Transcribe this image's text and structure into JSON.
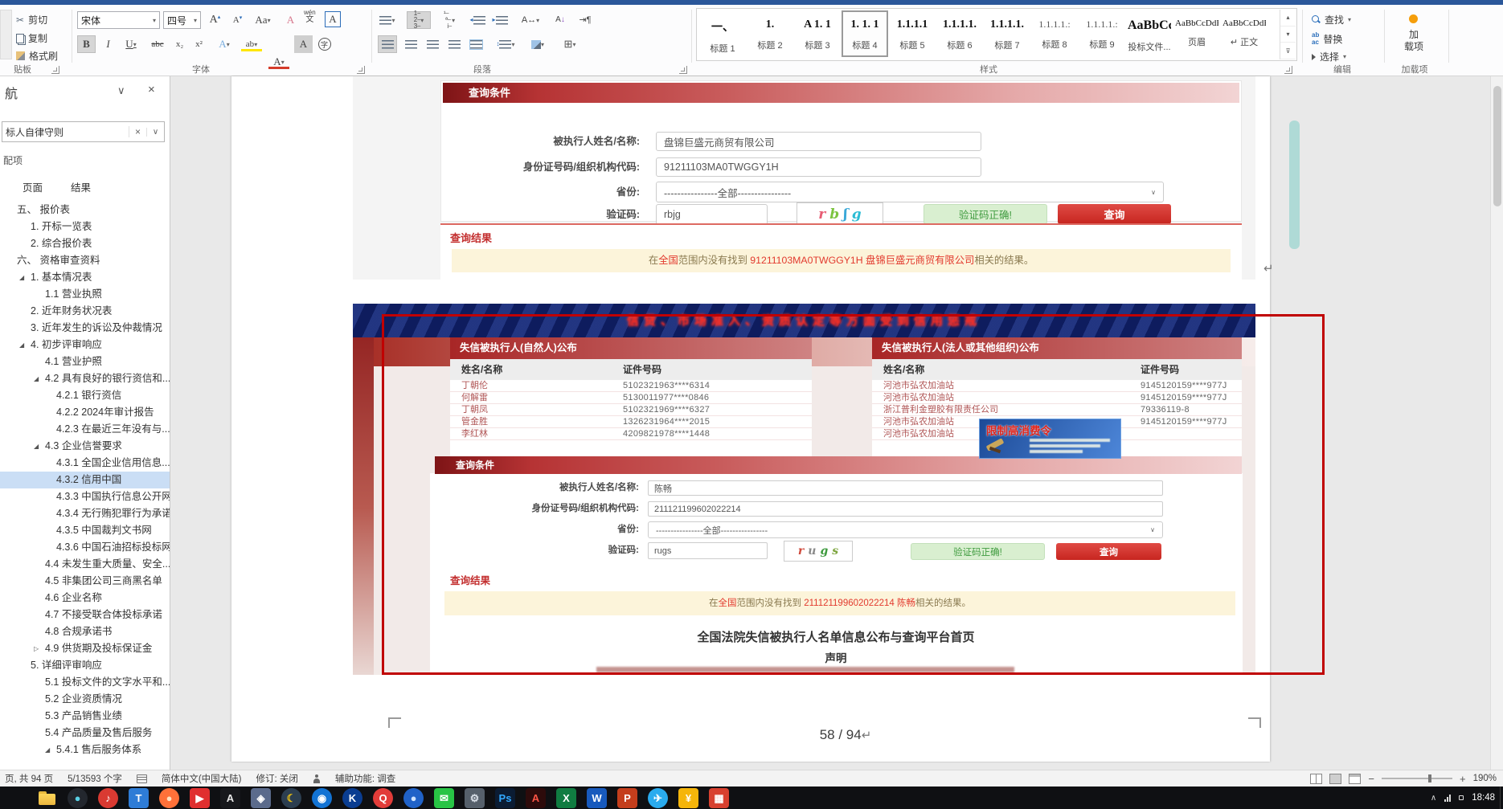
{
  "ribbon": {
    "clipboard": {
      "cut": "剪切",
      "copy": "复制",
      "format_painter": "格式刷",
      "group": "贴板"
    },
    "font": {
      "name": "宋体",
      "size": "四号",
      "grow": "A",
      "shrink": "A",
      "case_btn": "Aa",
      "clear": "A",
      "phonetic_top": "wén",
      "phonetic_bottom": "文",
      "border_a": "A",
      "bold": "B",
      "italic": "I",
      "underline": "U",
      "strike": "abc",
      "sub": "x₂",
      "sup": "x²",
      "effect_a": "A",
      "highlight": "ab",
      "color_a": "A",
      "shade_a": "A",
      "enclose": "字",
      "group": "字体"
    },
    "paragraph": {
      "group": "段落",
      "sort": "A↓",
      "cjk": "A↔"
    },
    "styles": {
      "group": "样式",
      "items": [
        {
          "preview": "一、",
          "label": "标题 1"
        },
        {
          "preview": "1.",
          "label": "标题 2"
        },
        {
          "preview": "A 1. 1",
          "label": "标题 3"
        },
        {
          "preview": "1. 1. 1",
          "label": "标题 4",
          "selected": true
        },
        {
          "preview": "1.1.1.1",
          "label": "标题 5"
        },
        {
          "preview": "1.1.1.1.",
          "label": "标题 6"
        },
        {
          "preview": "1.1.1.1.",
          "label": "标题 7"
        },
        {
          "preview": "1.1.1.1.:",
          "label": "标题 8"
        },
        {
          "preview": "1.1.1.1.:",
          "label": "标题 9"
        },
        {
          "preview": "AaBbCc",
          "label": "投标文件..."
        },
        {
          "preview": "AaBbCcDdEe",
          "label": "页眉"
        },
        {
          "preview": "AaBbCcDdE",
          "label": "↵ 正文"
        }
      ]
    },
    "editing": {
      "find": "查找",
      "replace": "替换",
      "select": "选择",
      "group": "编辑"
    },
    "addins": {
      "line1": "加",
      "line2": "载项",
      "group": "加载项",
      "dot_color": "#f59e0b"
    }
  },
  "nav": {
    "title": "航",
    "collapse_icon": "∨",
    "close_icon": "×",
    "search_value": "标人自律守则",
    "clear_icon": "×",
    "dropdown_icon": "∨",
    "match_label": "配项",
    "tabs": [
      "页面",
      "结果"
    ],
    "items": [
      {
        "label": "五、 报价表",
        "level": 0
      },
      {
        "label": "1. 开标一览表",
        "level": 1
      },
      {
        "label": "2. 综合报价表",
        "level": 1
      },
      {
        "label": "六、 资格审查资料",
        "level": 0
      },
      {
        "label": "1. 基本情况表",
        "level": 1,
        "marker": "expanded"
      },
      {
        "label": "1.1 营业执照",
        "level": 2
      },
      {
        "label": "2. 近年财务状况表",
        "level": 1
      },
      {
        "label": "3. 近年发生的诉讼及仲裁情况",
        "level": 1
      },
      {
        "label": "4. 初步评审响应",
        "level": 1,
        "marker": "expanded"
      },
      {
        "label": "4.1 营业护照",
        "level": 2
      },
      {
        "label": "4.2 具有良好的银行资信和...",
        "level": 2,
        "marker": "expanded"
      },
      {
        "label": "4.2.1 银行资信",
        "level": 3
      },
      {
        "label": "4.2.2 2024年审计报告",
        "level": 3
      },
      {
        "label": "4.2.3 在最近三年没有与...",
        "level": 3
      },
      {
        "label": "4.3 企业信誉要求",
        "level": 2,
        "marker": "expanded"
      },
      {
        "label": "4.3.1 全国企业信用信息...",
        "level": 3
      },
      {
        "label": "4.3.2 信用中国",
        "level": 3,
        "selected": true
      },
      {
        "label": "4.3.3 中国执行信息公开网",
        "level": 3
      },
      {
        "label": "4.3.4 无行贿犯罪行为承诺",
        "level": 3
      },
      {
        "label": "4.3.5 中国裁判文书网",
        "level": 3
      },
      {
        "label": "4.3.6 中国石油招标投标网",
        "level": 3
      },
      {
        "label": "4.4 未发生重大质量、安全...",
        "level": 2
      },
      {
        "label": "4.5 非集团公司三商黑名单",
        "level": 2
      },
      {
        "label": "4.6 企业名称",
        "level": 2
      },
      {
        "label": "4.7 不接受联合体投标承诺",
        "level": 2
      },
      {
        "label": "4.8 合规承诺书",
        "level": 2
      },
      {
        "label": "4.9 供货期及投标保证金",
        "level": 2,
        "marker": "collapsed"
      },
      {
        "label": "5. 详细评审响应",
        "level": 1
      },
      {
        "label": "5.1 投标文件的文字水平和...",
        "level": 2
      },
      {
        "label": "5.2 企业资质情况",
        "level": 2
      },
      {
        "label": "5.3 产品销售业绩",
        "level": 2
      },
      {
        "label": "5.4 产品质量及售后服务",
        "level": 2
      },
      {
        "label": "5.4.1 售后服务体系",
        "level": 3,
        "marker": "expanded"
      }
    ]
  },
  "doc": {
    "shot1": {
      "section_title": "查询条件",
      "fields": [
        {
          "label": "被执行人姓名/名称:",
          "value": "盘锦巨盛元商贸有限公司"
        },
        {
          "label": "身份证号码/组织机构代码:",
          "value": "91211103MA0TWGGY1H"
        },
        {
          "label": "省份:",
          "value": "----------------全部----------------"
        },
        {
          "label": "验证码:",
          "value": "rbjg"
        }
      ],
      "captcha": [
        {
          "c": "r",
          "color": "#e75d74"
        },
        {
          "c": "b",
          "color": "#7cc440"
        },
        {
          "c": "ʃ",
          "color": "#3aa8d8"
        },
        {
          "c": "g",
          "color": "#2bbcd4"
        }
      ],
      "verify_button": "验证码正确!",
      "query_button": "查询",
      "result_title": "查询结果",
      "result": {
        "pre": "在",
        "hl1": "全国",
        "mid": "范围内没有找到 ",
        "hl2": "91211103MA0TWGGY1H 盘锦巨盛元商贸有限公司",
        "post": "相关的结果。"
      }
    },
    "shot2": {
      "banner_text": "信贷、市场准入、资质认定等方面受到信用惩戒",
      "natural": {
        "title": "失信被执行人(自然人)公布",
        "col_name": "姓名/名称",
        "col_id": "证件号码",
        "rows": [
          [
            "丁朝伦",
            "5102321963****6314"
          ],
          [
            "何解雷",
            "5130011977****0846"
          ],
          [
            "丁朝凤",
            "5102321969****6327"
          ],
          [
            "管金胜",
            "1326231964****2015"
          ],
          [
            "李红林",
            "4209821978****1448"
          ]
        ]
      },
      "org": {
        "title": "失信被执行人(法人或其他组织)公布",
        "col_name": "姓名/名称",
        "col_id": "证件号码",
        "rows": [
          [
            "河池市弘农加油站",
            "9145120159****977J"
          ],
          [
            "河池市弘农加油站",
            "9145120159****977J"
          ],
          [
            "浙江普利金塑胶有限责任公司",
            "79336119-8"
          ],
          [
            "河池市弘农加油站",
            "9145120159****977J"
          ],
          [
            "河池市弘农加油站",
            ""
          ]
        ]
      },
      "overlay_title": "限制高消费令",
      "section_title": "查询条件",
      "fields": [
        {
          "label": "被执行人姓名/名称:",
          "value": "陈畅"
        },
        {
          "label": "身份证号码/组织机构代码:",
          "value": "211121199602022214"
        },
        {
          "label": "省份:",
          "value": "----------------全部----------------"
        },
        {
          "label": "验证码:",
          "value": "rugs"
        }
      ],
      "captcha": [
        {
          "c": "r",
          "color": "#cf4a3c"
        },
        {
          "c": "u",
          "color": "#8a8a8a"
        },
        {
          "c": "g",
          "color": "#3f9b3f"
        },
        {
          "c": "s",
          "color": "#7da53f"
        }
      ],
      "verify_button": "验证码正确!",
      "query_button": "查询",
      "result_title": "查询结果",
      "result": {
        "pre": "在",
        "hl1": "全国",
        "mid": "范围内没有找到 ",
        "hl2": "211121199602022214 陈畅",
        "post": "相关的结果。"
      },
      "footer_title": "全国法院失信被执行人名单信息公布与查询平台首页",
      "footer_sub": "声明"
    },
    "page_number": "58 / 94",
    "pilcrow": "↵"
  },
  "status": {
    "page_info": "页, 共 94 页",
    "word_count": "5/13593 个字",
    "language": "简体中文(中国大陆)",
    "track": "修订: 关闭",
    "accessibility": "辅助功能: 调查",
    "zoom": "190%",
    "zoom_minus": "−",
    "zoom_plus": "+"
  },
  "taskbar": {
    "time": "18:48",
    "tray_chevron": "∧",
    "icons": [
      {
        "name": "start-button",
        "type": "start"
      },
      {
        "name": "file-explorer",
        "type": "folder"
      },
      {
        "name": "app-media-dark",
        "shape": "circle",
        "bg": "#23272e",
        "fg": "#5ad1e6",
        "glyph": "●"
      },
      {
        "name": "app-music-red",
        "shape": "circle",
        "bg": "#d93a32",
        "fg": "#ffffff",
        "glyph": "♪"
      },
      {
        "name": "app-tim",
        "bg": "#2e7cd6",
        "fg": "#ffffff",
        "glyph": "T"
      },
      {
        "name": "app-firefox",
        "shape": "circle",
        "bg": "#ff7139",
        "fg": "#ffe3c2",
        "glyph": "●"
      },
      {
        "name": "app-video",
        "bg": "#e02f2f",
        "fg": "#ffffff",
        "glyph": "▶"
      },
      {
        "name": "app-black-a",
        "bg": "#17181c",
        "fg": "#e8e8e8",
        "glyph": "A"
      },
      {
        "name": "app-diamond",
        "bg": "#5b6b8c",
        "fg": "#ffffff",
        "glyph": "◈"
      },
      {
        "name": "app-night",
        "shape": "circle",
        "bg": "#2c3e50",
        "fg": "#f1c40f",
        "glyph": "☾"
      },
      {
        "name": "app-compass",
        "shape": "circle",
        "bg": "#1273d4",
        "fg": "#ffffff",
        "glyph": "◉"
      },
      {
        "name": "app-globe-k",
        "shape": "circle",
        "bg": "#0a3d91",
        "fg": "#ffffff",
        "glyph": "K"
      },
      {
        "name": "app-q-music",
        "shape": "circle",
        "bg": "#e23c39",
        "fg": "#ffffff",
        "glyph": "Q"
      },
      {
        "name": "app-globe",
        "shape": "circle",
        "bg": "#2062c8",
        "fg": "#cfe3ff",
        "glyph": "●"
      },
      {
        "name": "app-mail-green",
        "bg": "#28c445",
        "fg": "#ffffff",
        "glyph": "✉"
      },
      {
        "name": "app-settings",
        "bg": "#56606b",
        "fg": "#d8dee6",
        "glyph": "⚙"
      },
      {
        "name": "app-photoshop",
        "bg": "#0b1c33",
        "fg": "#31a8ff",
        "glyph": "Ps"
      },
      {
        "name": "app-acrobat",
        "bg": "#2d0b0b",
        "fg": "#ff5445",
        "glyph": "A"
      },
      {
        "name": "app-excel",
        "bg": "#107c41",
        "fg": "#ffffff",
        "glyph": "X"
      },
      {
        "name": "app-word",
        "bg": "#185abd",
        "fg": "#ffffff",
        "glyph": "W"
      },
      {
        "name": "app-powerpoint",
        "bg": "#c43e1c",
        "fg": "#ffffff",
        "glyph": "P"
      },
      {
        "name": "app-telegram",
        "shape": "circle",
        "bg": "#2aabee",
        "fg": "#ffffff",
        "glyph": "✈"
      },
      {
        "name": "app-pay",
        "bg": "#f5b50a",
        "fg": "#ffffff",
        "glyph": "¥"
      },
      {
        "name": "app-remote",
        "bg": "#d8402f",
        "fg": "#ffffff",
        "glyph": "▦"
      }
    ]
  }
}
